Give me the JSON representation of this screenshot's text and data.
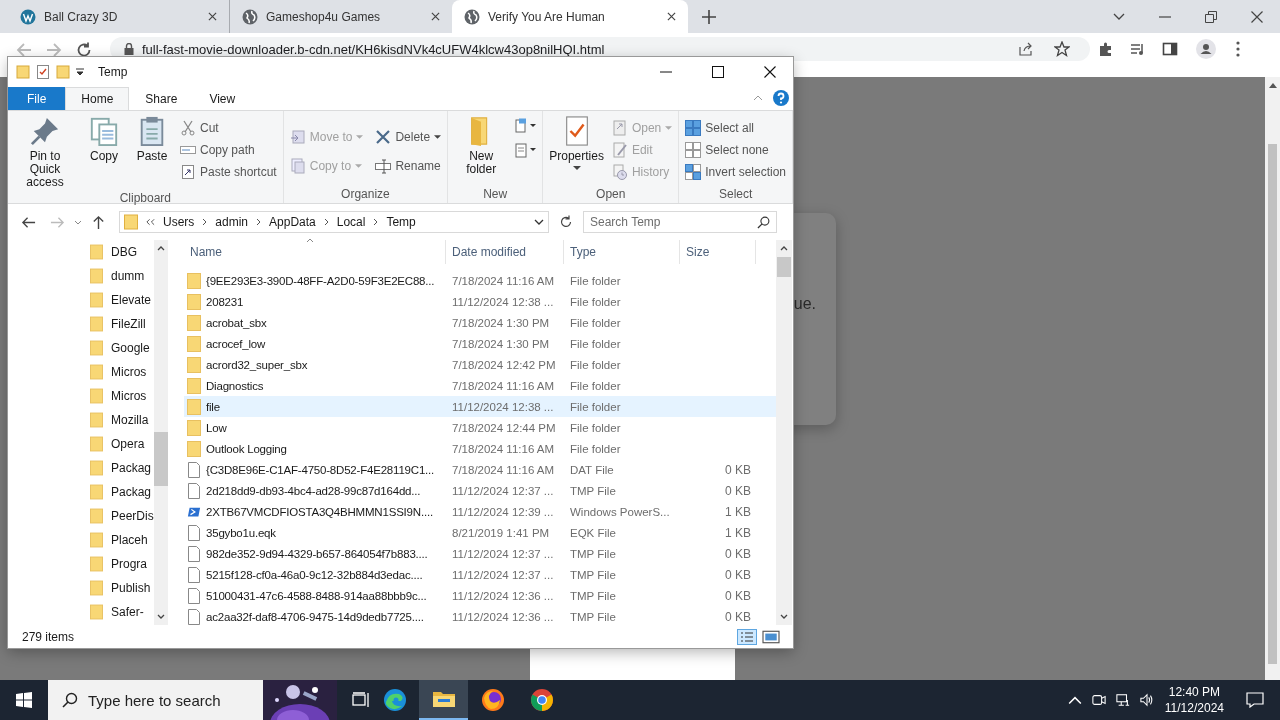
{
  "browser": {
    "tabs": [
      {
        "title": "Ball Crazy 3D",
        "kind": "wordpress",
        "selected": false
      },
      {
        "title": "Gameshop4u Games",
        "kind": "globe",
        "selected": false
      },
      {
        "title": "Verify You Are Human",
        "kind": "globe",
        "selected": true
      }
    ],
    "url": "full-fast-movie-downloader.b-cdn.net/KH6kisdNVk4cUFW4klcw43op8nilHQI.html",
    "page": {
      "card_text": "ue."
    }
  },
  "explorer": {
    "title": "Temp",
    "ribbon_tabs": [
      {
        "label": "File",
        "kind": "file",
        "selected": false
      },
      {
        "label": "Home",
        "kind": "tab",
        "selected": true
      },
      {
        "label": "Share",
        "kind": "tab",
        "selected": false
      },
      {
        "label": "View",
        "kind": "tab",
        "selected": false
      }
    ],
    "groups": [
      {
        "label": "Clipboard",
        "buttons": [
          {
            "label": "Pin to Quick access",
            "kind": "large",
            "disabled": false
          },
          {
            "label": "Copy",
            "kind": "large",
            "disabled": false
          },
          {
            "label": "Paste",
            "kind": "large",
            "disabled": false
          },
          {
            "label": "Cut",
            "kind": "small",
            "disabled": false
          },
          {
            "label": "Copy path",
            "kind": "small",
            "disabled": false
          },
          {
            "label": "Paste shortcut",
            "kind": "small",
            "disabled": false
          }
        ]
      },
      {
        "label": "Organize",
        "buttons": [
          {
            "label": "Move to",
            "kind": "small",
            "disabled": true,
            "dropdown": true
          },
          {
            "label": "Copy to",
            "kind": "small",
            "disabled": true,
            "dropdown": true
          },
          {
            "label": "Delete",
            "kind": "small",
            "disabled": false,
            "dropdown": true
          },
          {
            "label": "Rename",
            "kind": "small",
            "disabled": false
          }
        ]
      },
      {
        "label": "New",
        "buttons": [
          {
            "label": "New folder",
            "kind": "large",
            "disabled": false
          }
        ]
      },
      {
        "label": "Open",
        "buttons": [
          {
            "label": "Properties",
            "kind": "large",
            "disabled": false,
            "dropdown": true
          },
          {
            "label": "Open",
            "kind": "small",
            "disabled": true,
            "dropdown": true
          },
          {
            "label": "Edit",
            "kind": "small",
            "disabled": true
          },
          {
            "label": "History",
            "kind": "small",
            "disabled": true
          }
        ]
      },
      {
        "label": "Select",
        "buttons": [
          {
            "label": "Select all",
            "kind": "small",
            "disabled": false
          },
          {
            "label": "Select none",
            "kind": "small",
            "disabled": false
          },
          {
            "label": "Invert selection",
            "kind": "small",
            "disabled": false
          }
        ]
      }
    ],
    "breadcrumbs": [
      "Users",
      "admin",
      "AppData",
      "Local",
      "Temp"
    ],
    "search": {
      "placeholder": "Search Temp"
    },
    "nav_items": [
      "DBG",
      "dumm",
      "Elevate",
      "FileZill",
      "Google",
      "Micros",
      "Micros",
      "Mozilla",
      "Opera",
      "Packag",
      "Packag",
      "PeerDis",
      "Placeh",
      "Progra",
      "Publish",
      "Safer-"
    ],
    "columns": [
      "Name",
      "Date modified",
      "Type",
      "Size"
    ],
    "rows": [
      {
        "kind": "folder",
        "name": "{9EE293E3-390D-48FF-A2D0-59F3E2EC88...",
        "date": "7/18/2024 11:16 AM",
        "type": "File folder",
        "size": "",
        "selected": false
      },
      {
        "kind": "folder",
        "name": "208231",
        "date": "11/12/2024 12:38 ...",
        "type": "File folder",
        "size": "",
        "selected": false
      },
      {
        "kind": "folder",
        "name": "acrobat_sbx",
        "date": "7/18/2024 1:30 PM",
        "type": "File folder",
        "size": "",
        "selected": false
      },
      {
        "kind": "folder",
        "name": "acrocef_low",
        "date": "7/18/2024 1:30 PM",
        "type": "File folder",
        "size": "",
        "selected": false
      },
      {
        "kind": "folder",
        "name": "acrord32_super_sbx",
        "date": "7/18/2024 12:42 PM",
        "type": "File folder",
        "size": "",
        "selected": false
      },
      {
        "kind": "folder",
        "name": "Diagnostics",
        "date": "7/18/2024 11:16 AM",
        "type": "File folder",
        "size": "",
        "selected": false
      },
      {
        "kind": "folder",
        "name": "file",
        "date": "11/12/2024 12:38 ...",
        "type": "File folder",
        "size": "",
        "selected": true
      },
      {
        "kind": "folder",
        "name": "Low",
        "date": "7/18/2024 12:44 PM",
        "type": "File folder",
        "size": "",
        "selected": false
      },
      {
        "kind": "folder",
        "name": "Outlook Logging",
        "date": "7/18/2024 11:16 AM",
        "type": "File folder",
        "size": "",
        "selected": false
      },
      {
        "kind": "file",
        "name": "{C3D8E96E-C1AF-4750-8D52-F4E28119C1...",
        "date": "7/18/2024 11:16 AM",
        "type": "DAT File",
        "size": "0 KB",
        "selected": false
      },
      {
        "kind": "file",
        "name": "2d218dd9-db93-4bc4-ad28-99c87d164dd...",
        "date": "11/12/2024 12:37 ...",
        "type": "TMP File",
        "size": "0 KB",
        "selected": false
      },
      {
        "kind": "script",
        "name": "2XTB67VMCDFIOSTA3Q4BHMMN1SSI9N....",
        "date": "11/12/2024 12:39 ...",
        "type": "Windows PowerS...",
        "size": "1 KB",
        "selected": false
      },
      {
        "kind": "file",
        "name": "35gybo1u.eqk",
        "date": "8/21/2019 1:41 PM",
        "type": "EQK File",
        "size": "1 KB",
        "selected": false
      },
      {
        "kind": "file",
        "name": "982de352-9d94-4329-b657-864054f7b883....",
        "date": "11/12/2024 12:37 ...",
        "type": "TMP File",
        "size": "0 KB",
        "selected": false
      },
      {
        "kind": "file",
        "name": "5215f128-cf0a-46a0-9c12-32b884d3edac....",
        "date": "11/12/2024 12:37 ...",
        "type": "TMP File",
        "size": "0 KB",
        "selected": false
      },
      {
        "kind": "file",
        "name": "51000431-47c6-4588-8488-914aa88bbb9c...",
        "date": "11/12/2024 12:36 ...",
        "type": "TMP File",
        "size": "0 KB",
        "selected": false
      },
      {
        "kind": "file",
        "name": "ac2aa32f-daf8-4706-9475-14d9dedb7725....",
        "date": "11/12/2024 12:36 ...",
        "type": "TMP File",
        "size": "0 KB",
        "selected": false
      }
    ],
    "status": "279 items"
  },
  "taskbar": {
    "search": {
      "placeholder": "Type here to search"
    },
    "apps": [
      {
        "kind": "edge",
        "selected": false
      },
      {
        "kind": "explorer",
        "selected": true
      },
      {
        "kind": "firefox",
        "selected": false
      },
      {
        "kind": "chrome",
        "selected": false
      }
    ],
    "time": "12:40 PM",
    "date": "11/12/2024"
  }
}
